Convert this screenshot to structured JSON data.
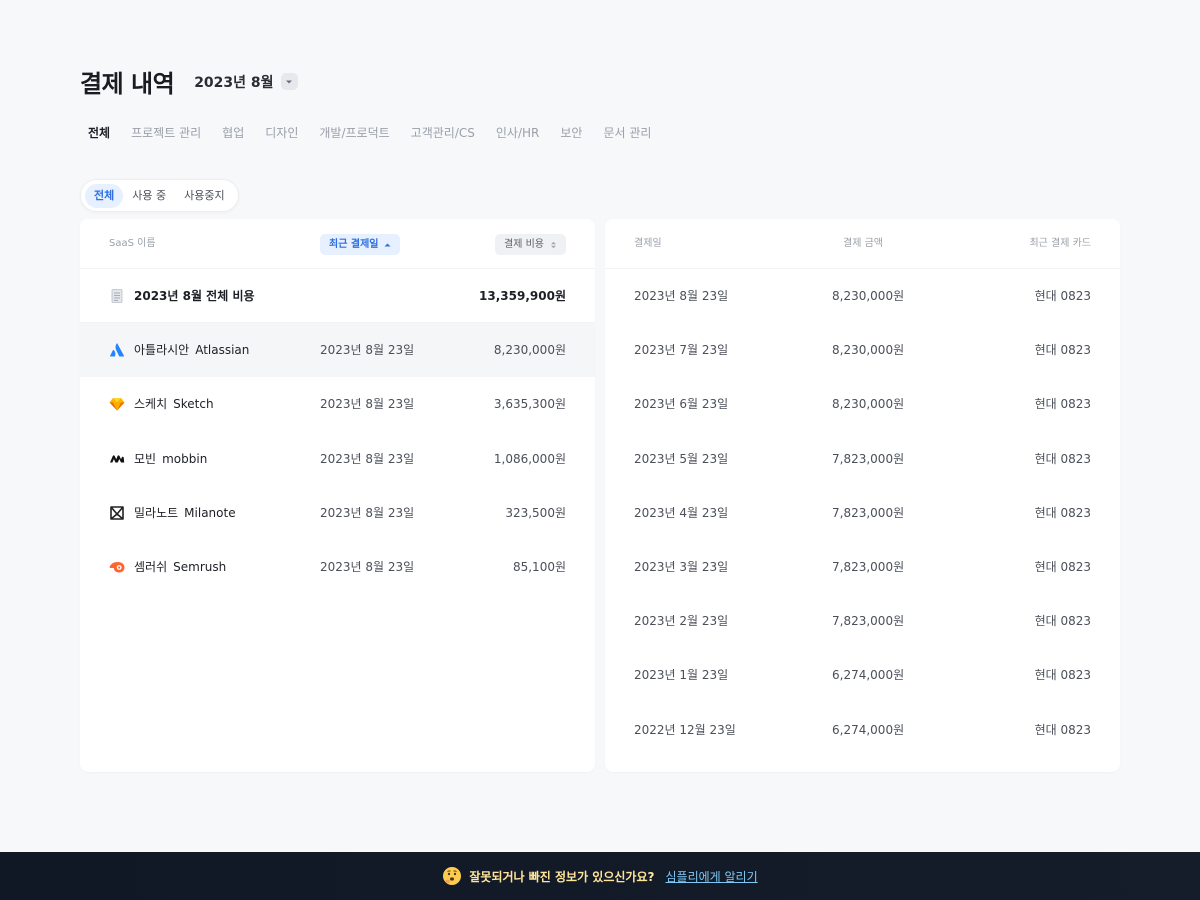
{
  "header": {
    "title": "결제 내역",
    "period": "2023년 8월"
  },
  "category_tabs": [
    "전체",
    "프로젝트 관리",
    "협업",
    "디자인",
    "개발/프로덕트",
    "고객관리/CS",
    "인사/HR",
    "보안",
    "문서 관리"
  ],
  "status_filter": [
    "전체",
    "사용 중",
    "사용중지"
  ],
  "left_table": {
    "headers": {
      "name": "SaaS 이름",
      "date": "최근 결제일",
      "cost": "결제 비용"
    },
    "total": {
      "label": "2023년 8월 전체 비용",
      "amount": "13,359,900원",
      "icon": "receipt-icon"
    },
    "rows": [
      {
        "ko": "아틀라시안",
        "en": "Atlassian",
        "date": "2023년 8월 23일",
        "amount": "8,230,000원",
        "icon": "atlassian-logo-icon",
        "color": "#2684ff"
      },
      {
        "ko": "스케치",
        "en": "Sketch",
        "date": "2023년 8월 23일",
        "amount": "3,635,300원",
        "icon": "sketch-logo-icon",
        "color": "#fdb300"
      },
      {
        "ko": "모빈",
        "en": "mobbin",
        "date": "2023년 8월 23일",
        "amount": "1,086,000원",
        "icon": "mobbin-logo-icon",
        "color": "#111111"
      },
      {
        "ko": "밀라노트",
        "en": "Milanote",
        "date": "2023년 8월 23일",
        "amount": "323,500원",
        "icon": "milanote-logo-icon",
        "color": "#222222"
      },
      {
        "ko": "셈러쉬",
        "en": "Semrush",
        "date": "2023년 8월 23일",
        "amount": "85,100원",
        "icon": "semrush-logo-icon",
        "color": "#ff642d"
      }
    ]
  },
  "right_table": {
    "headers": {
      "date": "결제일",
      "amount": "결제 금액",
      "card": "최근 결제 카드"
    },
    "rows": [
      {
        "date": "2023년 8월 23일",
        "amount": "8,230,000원",
        "card": "현대 0823"
      },
      {
        "date": "2023년 7월 23일",
        "amount": "8,230,000원",
        "card": "현대 0823"
      },
      {
        "date": "2023년 6월 23일",
        "amount": "8,230,000원",
        "card": "현대 0823"
      },
      {
        "date": "2023년 5월 23일",
        "amount": "7,823,000원",
        "card": "현대 0823"
      },
      {
        "date": "2023년 4월 23일",
        "amount": "7,823,000원",
        "card": "현대 0823"
      },
      {
        "date": "2023년 3월 23일",
        "amount": "7,823,000원",
        "card": "현대 0823"
      },
      {
        "date": "2023년 2월 23일",
        "amount": "7,823,000원",
        "card": "현대 0823"
      },
      {
        "date": "2023년 1월 23일",
        "amount": "6,274,000원",
        "card": "현대 0823"
      },
      {
        "date": "2022년 12월 23일",
        "amount": "6,274,000원",
        "card": "현대 0823"
      }
    ]
  },
  "banner": {
    "text": "잘못되거나 빠진 정보가 있으신가요?",
    "link": "심플리에게 알리기",
    "icon": "thinking-face-icon"
  },
  "colors": {
    "accent": "#2f6fe3",
    "accent_bg": "#e6f0fe",
    "banner_text": "#ffe59a",
    "banner_link": "#7ec8f5"
  }
}
